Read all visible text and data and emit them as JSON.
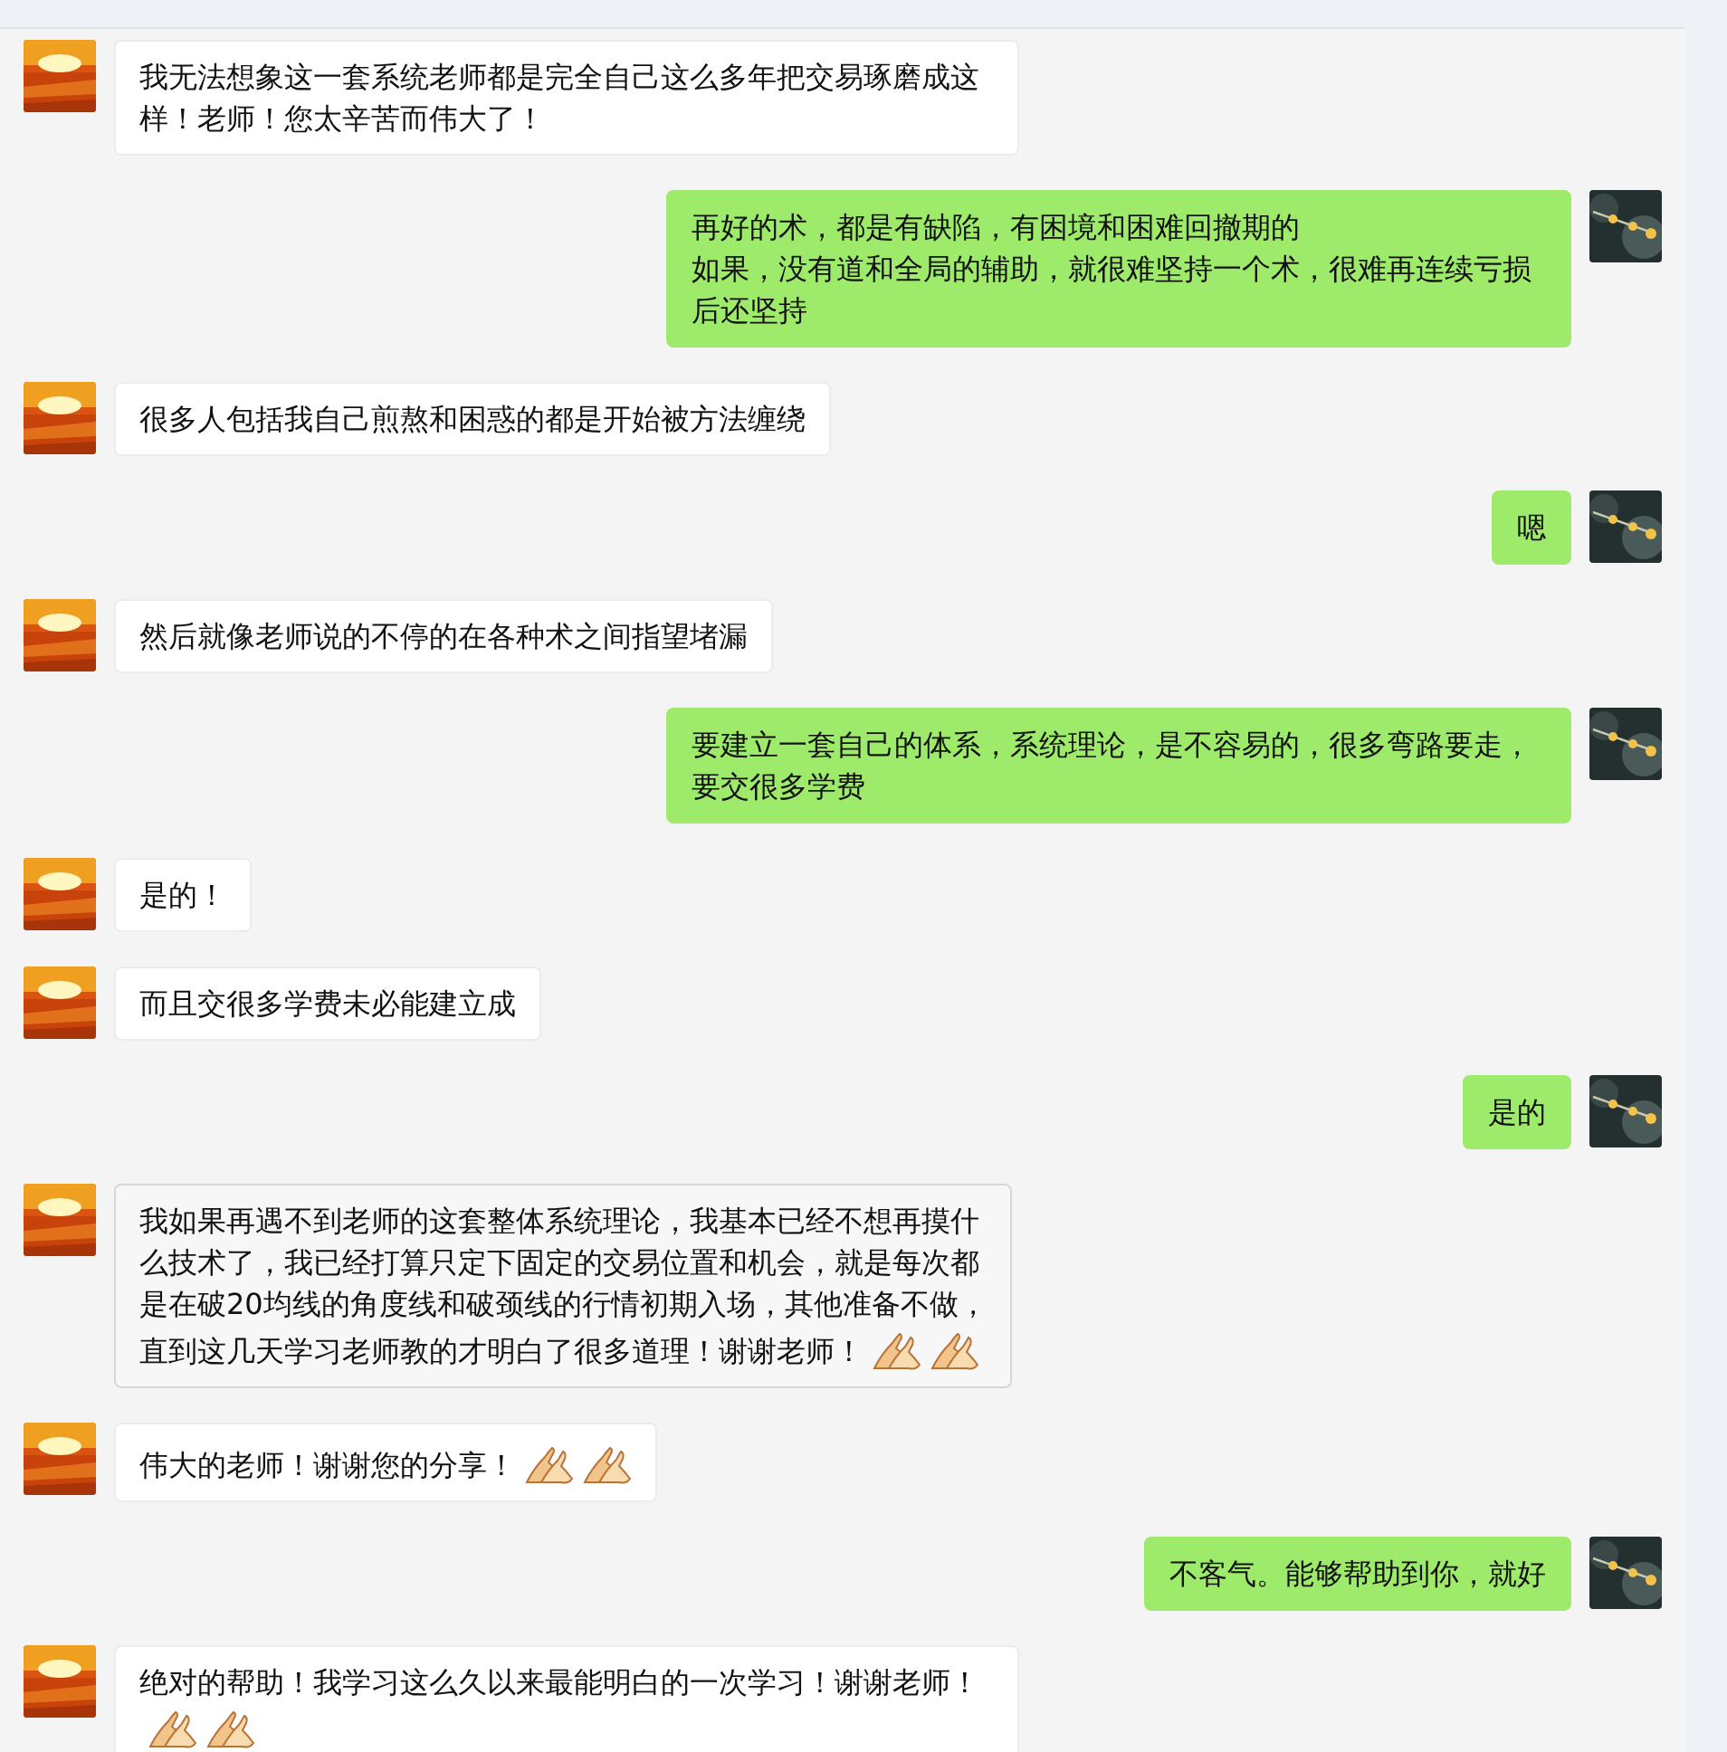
{
  "messages": [
    {
      "kind": "received",
      "lines": [
        "我无法想象这一套系统老师都是完全自己这么多年把交易琢磨成这样！老师！您太辛苦而伟大了！"
      ]
    },
    {
      "kind": "sent",
      "lines": [
        "再好的术，都是有缺陷，有困境和困难回撤期的",
        "如果，没有道和全局的辅助，就很难坚持一个术，很难再连续亏损后还坚持"
      ]
    },
    {
      "kind": "received",
      "lines": [
        "很多人包括我自己煎熬和困惑的都是开始被方法缠绕"
      ]
    },
    {
      "kind": "sent",
      "lines": [
        "嗯"
      ]
    },
    {
      "kind": "received",
      "lines": [
        "然后就像老师说的不停的在各种术之间指望堵漏"
      ]
    },
    {
      "kind": "sent",
      "lines": [
        "要建立一套自己的体系，系统理论，是不容易的，很多弯路要走，要交很多学费"
      ]
    },
    {
      "kind": "received",
      "lines": [
        "是的！"
      ]
    },
    {
      "kind": "received",
      "lines": [
        "而且交很多学费未必能建立成"
      ]
    },
    {
      "kind": "sent",
      "lines": [
        "是的"
      ]
    },
    {
      "kind": "received",
      "highlighted": true,
      "lines": [
        "我如果再遇不到老师的这套整体系统理论，我基本已经不想再摸什",
        "么技术了，我已经打算只定下固定的交易位置和机会，就是每次都",
        "是在破20均线的角度线和破颈线的行情初期入场，其他准备不做，",
        "直到这几天学习老师教的才明白了很多道理！谢谢老师！"
      ],
      "emoji": [
        {
          "kind": "clap"
        },
        {
          "kind": "clap"
        }
      ]
    },
    {
      "kind": "received",
      "lines": [
        "伟大的老师！谢谢您的分享！"
      ],
      "emoji": [
        {
          "kind": "clap"
        },
        {
          "kind": "clap"
        }
      ]
    },
    {
      "kind": "sent",
      "lines": [
        "不客气。能够帮助到你，就好"
      ]
    },
    {
      "kind": "received",
      "lines": [
        "绝对的帮助！我学习这么久以来最能明白的一次学习！谢谢老师！"
      ],
      "emoji": [
        {
          "kind": "clap"
        },
        {
          "kind": "clap"
        }
      ]
    }
  ]
}
